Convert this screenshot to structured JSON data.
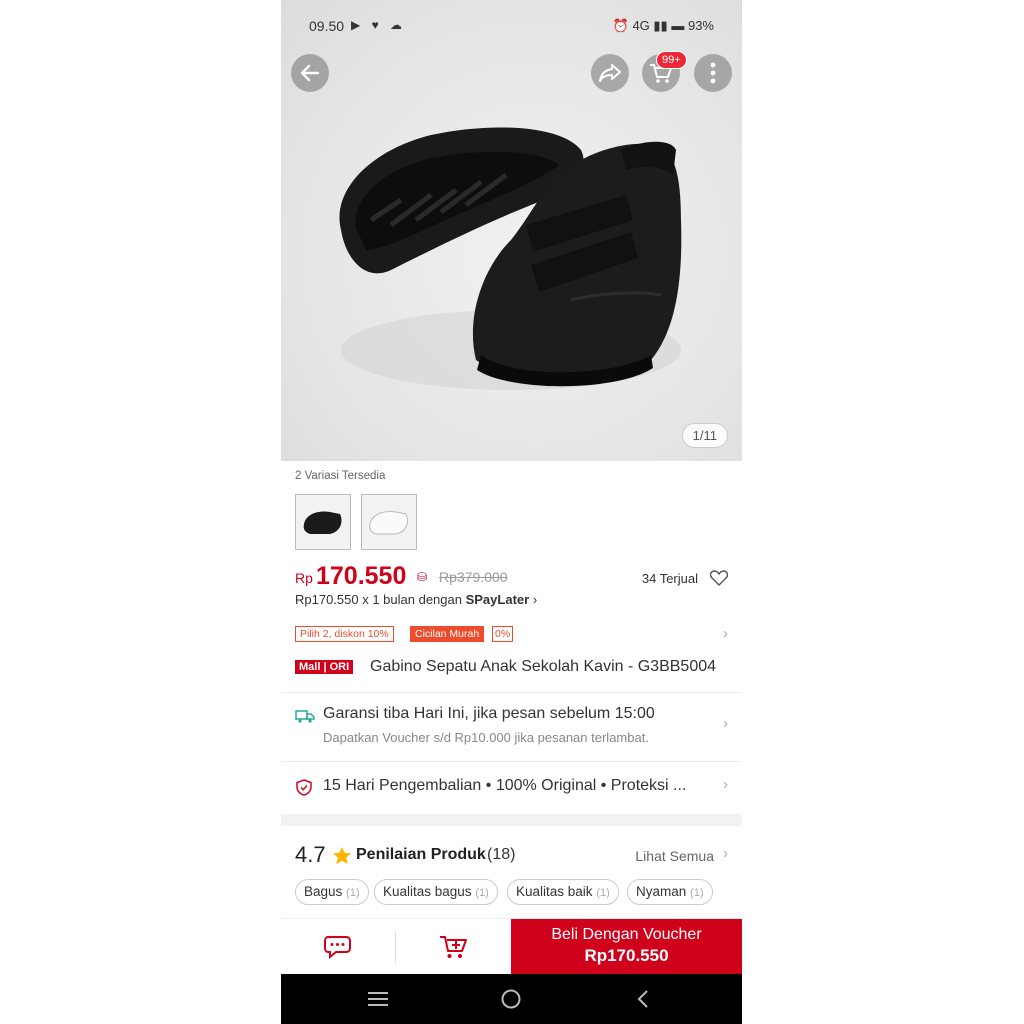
{
  "status_bar": {
    "time": "09.50",
    "network": "4G",
    "battery": "93%"
  },
  "cart": {
    "badge": "99+"
  },
  "gallery": {
    "counter": "1/11"
  },
  "variations": {
    "label": "2 Variasi Tersedia",
    "items": [
      "black",
      "white"
    ]
  },
  "price": {
    "currency": "Rp",
    "current": "170.550",
    "original": "Rp379.000",
    "sold": "34 Terjual"
  },
  "paylater": {
    "text": "Rp170.550 x 1 bulan dengan ",
    "brand": "SPayLater"
  },
  "promos": {
    "discount": "Pilih 2, diskon 10%",
    "installment": "Cicilan Murah",
    "installment_rate": "0%"
  },
  "product": {
    "badge": "Mall | ORI",
    "title": "Gabino Sepatu Anak Sekolah Kavin - G3BB5004"
  },
  "shipping": {
    "title": "Garansi tiba Hari Ini, jika pesan sebelum 15:00",
    "subtitle": "Dapatkan Voucher s/d Rp10.000 jika pesanan terlambat."
  },
  "guarantees": {
    "text": "15 Hari Pengembalian  •  100% Original  •  Proteksi ..."
  },
  "rating": {
    "score": "4.7",
    "label": "Penilaian Produk",
    "count": "(18)",
    "see_all": "Lihat Semua",
    "chips": [
      {
        "label": "Bagus",
        "count": "(1)"
      },
      {
        "label": "Kualitas bagus",
        "count": "(1)"
      },
      {
        "label": "Kualitas baik",
        "count": "(1)"
      },
      {
        "label": "Nyaman",
        "count": "(1)"
      }
    ]
  },
  "buy": {
    "line1": "Beli Dengan Voucher",
    "line2": "Rp170.550"
  },
  "colors": {
    "brand_red": "#d0011b",
    "promo_orange": "#ee4d2d"
  }
}
